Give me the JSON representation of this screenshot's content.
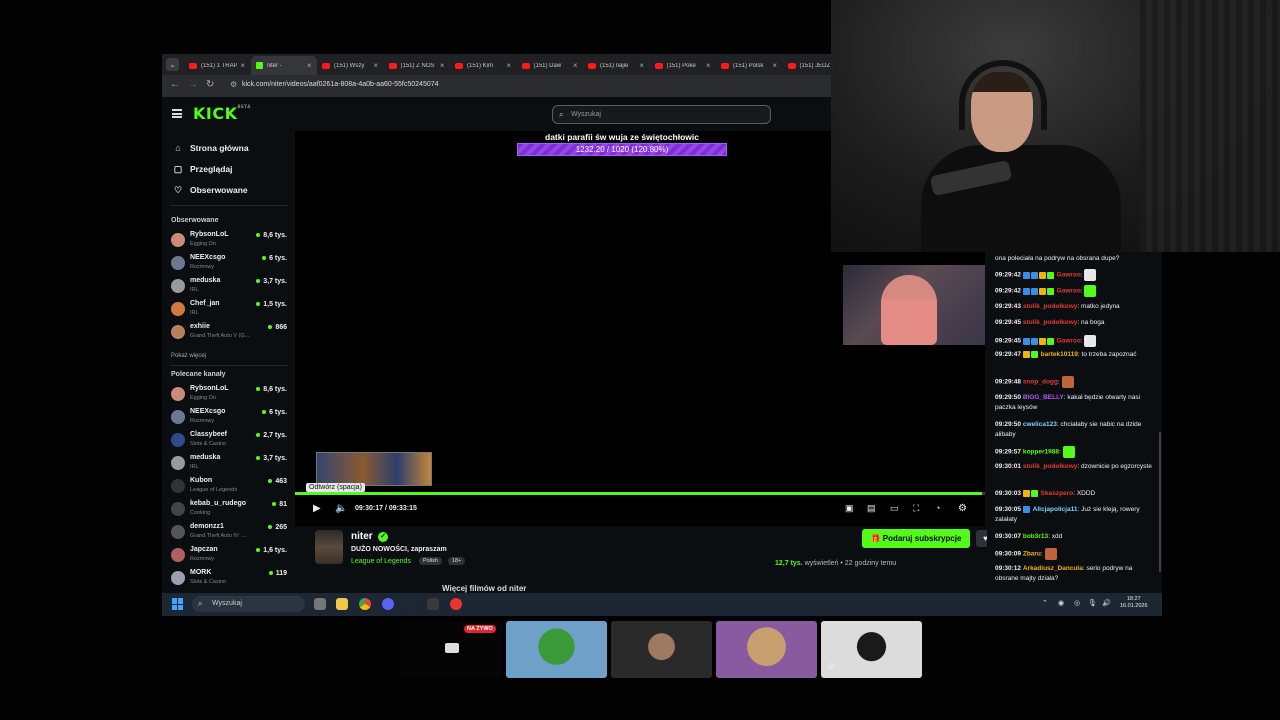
{
  "tabs": [
    {
      "title": "(151) 1 TRAP",
      "icon": "youtube-icon"
    },
    {
      "title": "niter - ",
      "icon": "kick-icon"
    },
    {
      "title": "(151) Wszy",
      "icon": "youtube-icon"
    },
    {
      "title": "(151) Z NOS",
      "icon": "youtube-icon"
    },
    {
      "title": "(151) Kim",
      "icon": "youtube-icon"
    },
    {
      "title": "(151) Daw",
      "icon": "youtube-icon"
    },
    {
      "title": "(151) najle",
      "icon": "youtube-icon"
    },
    {
      "title": "(151) Poke",
      "icon": "youtube-icon"
    },
    {
      "title": "(151) Polsk",
      "icon": "youtube-icon"
    },
    {
      "title": "(151) JEDZ",
      "icon": "youtube-icon"
    }
  ],
  "address": "kick.com/niter/videos/aaf0261a-808a-4a0b-aa60-55fc50245074",
  "kick": {
    "logo": "KICK",
    "logo_beta": "BETA",
    "search_placeholder": "Wyszukaj"
  },
  "nav": [
    {
      "label": "Strona główna",
      "icon": "home-icon"
    },
    {
      "label": "Przeglądaj",
      "icon": "browse-icon"
    },
    {
      "label": "Obserwowane",
      "icon": "heart-icon"
    }
  ],
  "followed_header": "Obserwowane",
  "followed": [
    {
      "name": "RybsonLoL",
      "category": "Egging On",
      "viewers": "8,6 tys.",
      "color": "#c98a7a"
    },
    {
      "name": "NEEXcsgo",
      "category": "Rozmowy",
      "viewers": "6 tys.",
      "color": "#6b7a92"
    },
    {
      "name": "meduska",
      "category": "IRL",
      "viewers": "3,7 tys.",
      "color": "#9a9a9a"
    },
    {
      "name": "Chef_jan",
      "category": "IRL",
      "viewers": "1,5 tys.",
      "color": "#d07840"
    },
    {
      "name": "exhiie",
      "category": "Grand Theft Auto V (G...",
      "viewers": "866",
      "color": "#b58060"
    }
  ],
  "show_more": "Pokaż więcej",
  "recommended_header": "Polecane kanały",
  "recommended": [
    {
      "name": "RybsonLoL",
      "category": "Egging On",
      "viewers": "8,6 tys.",
      "color": "#c98a7a"
    },
    {
      "name": "NEEXcsgo",
      "category": "Rozmowy",
      "viewers": "6 tys.",
      "color": "#6b7a92"
    },
    {
      "name": "Classybeef",
      "category": "Slots & Casino",
      "viewers": "2,7 tys.",
      "color": "#2f4a8a"
    },
    {
      "name": "meduska",
      "category": "IRL",
      "viewers": "3,7 tys.",
      "color": "#9a9a9a"
    },
    {
      "name": "Kubon",
      "category": "League of Legends",
      "viewers": "463",
      "color": "#333"
    },
    {
      "name": "kebab_u_rudego",
      "category": "Cooking",
      "viewers": "81",
      "color": "#444"
    },
    {
      "name": "demonzz1",
      "category": "Grand Theft Auto IV: ...",
      "viewers": "265",
      "color": "#555"
    },
    {
      "name": "Japczan",
      "category": "Rozmowy",
      "viewers": "1,6 tys.",
      "color": "#b06060"
    },
    {
      "name": "MORK",
      "category": "Slots & Casino",
      "viewers": "119",
      "color": "#9aa0b0"
    }
  ],
  "goal": {
    "title": "datki parafii św wuja ze świętochłowic",
    "progress_text": "1232.20 / 1020 (120.80%)",
    "fraction": 1.0
  },
  "player": {
    "tooltip": "Odtwórz (spacja)",
    "time": "09:30:17 / 09:33:15",
    "progress": 0.995
  },
  "channel": {
    "name": "niter",
    "title": "DUŻO NOWOŚCI, zapraszam",
    "category": "League of Legends",
    "tags": [
      "Polish",
      "18+"
    ],
    "subscribe": "Podaruj subskrypcje",
    "views": "12,7 tys.",
    "views_label": "wyświetleń",
    "ago": "22 godziny temu",
    "more_videos": "Więcej filmów od niter"
  },
  "taskbar": {
    "search": "Wyszukaj",
    "time": "18:27",
    "date": "16.01.2026"
  },
  "chat": [
    {
      "ts": "",
      "user": "",
      "user_color": "#fff",
      "text": "ona poleciała na podryw na obsrana dupe?",
      "badges": [],
      "emote": ""
    },
    {
      "ts": "09:29:42",
      "user": "Gawroo",
      "user_color": "#e5383b",
      "text": "",
      "badges": [
        "#3a8ee6",
        "#3a8ee6",
        "#f2b211",
        "#53fc18"
      ],
      "emote": "#e8e8e8"
    },
    {
      "ts": "09:29:42",
      "user": "Gawroo",
      "user_color": "#e5383b",
      "text": "",
      "badges": [
        "#3a8ee6",
        "#3a8ee6",
        "#f2b211",
        "#53fc18"
      ],
      "emote": "#53fc18"
    },
    {
      "ts": "09:29:43",
      "user": "stolik_podolkowy",
      "user_color": "#e5383b",
      "text": "matko jedyna",
      "badges": [],
      "emote": ""
    },
    {
      "ts": "09:29:45",
      "user": "stolik_podolkowy",
      "user_color": "#e5383b",
      "text": "na boga",
      "badges": [],
      "emote": ""
    },
    {
      "ts": "09:29:45",
      "user": "Gawroo",
      "user_color": "#e5383b",
      "text": "",
      "badges": [
        "#3a8ee6",
        "#3a8ee6",
        "#f2b211",
        "#53fc18"
      ],
      "emote": "#e8e8e8"
    },
    {
      "ts": "09:29:47",
      "user": "bartek10119",
      "user_color": "#f2b211",
      "text": "to trzeba zapoznać",
      "badges": [
        "#f2b211",
        "#53fc18"
      ],
      "emote": ""
    },
    {
      "ts": "09:29:48",
      "user": "snop_dogg",
      "user_color": "#e5383b",
      "text": "",
      "badges": [],
      "emote": "#c0643c"
    },
    {
      "ts": "09:29:50",
      "user": "BIGG_BELLY",
      "user_color": "#b45cf0",
      "text": "kakał będzie otwarty nasi paczka leysów",
      "badges": [],
      "emote": ""
    },
    {
      "ts": "09:29:50",
      "user": "cwelica123",
      "user_color": "#7fd0ff",
      "text": "chciałaby sie nabic na dzide alibaby",
      "badges": [],
      "emote": ""
    },
    {
      "ts": "09:29:57",
      "user": "kopper1988",
      "user_color": "#53fc18",
      "text": "",
      "badges": [],
      "emote": "#53fc18"
    },
    {
      "ts": "09:30:01",
      "user": "stolik_podolkowy",
      "user_color": "#e5383b",
      "text": "dzownicie po egzorcyste",
      "badges": [],
      "emote": ""
    },
    {
      "ts": "09:30:03",
      "user": "Skaszpero",
      "user_color": "#e5383b",
      "text": "XDDD",
      "badges": [
        "#f2b211",
        "#53fc18"
      ],
      "emote": ""
    },
    {
      "ts": "09:30:05",
      "user": "Allcjapolicja11",
      "user_color": "#7fd0ff",
      "text": "Już sie kleją, rowery zalałaty",
      "badges": [
        "#3a8ee6"
      ],
      "emote": ""
    },
    {
      "ts": "09:30:07",
      "user": "bob3r13",
      "user_color": "#53fc18",
      "text": "xdd",
      "badges": [],
      "emote": ""
    },
    {
      "ts": "09:30:09",
      "user": "Zbaru",
      "user_color": "#f2b211",
      "text": "",
      "badges": [],
      "emote": "#c0643c"
    },
    {
      "ts": "09:30:12",
      "user": "Arkadiusz_Danculа",
      "user_color": "#f2b211",
      "text": "serio podryw na obsrane majty działa?",
      "badges": [],
      "emote": ""
    }
  ],
  "live_badge": "NA ŻYWO",
  "colors": {
    "kick_green": "#53fc18",
    "goal_purple": "#8a3fe0"
  }
}
